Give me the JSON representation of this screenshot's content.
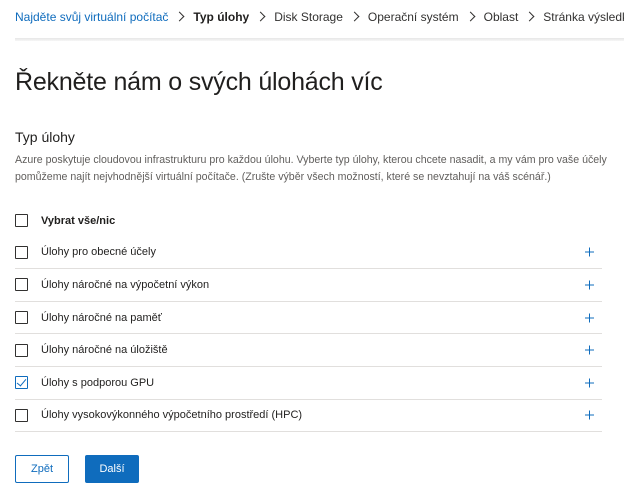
{
  "breadcrumb": {
    "items": [
      {
        "label": "Najděte svůj virtuální počítač",
        "state": "link"
      },
      {
        "label": "Typ úlohy",
        "state": "current"
      },
      {
        "label": "Disk Storage",
        "state": "default"
      },
      {
        "label": "Operační systém",
        "state": "default"
      },
      {
        "label": "Oblast",
        "state": "default"
      },
      {
        "label": "Stránka výsledků",
        "state": "default"
      }
    ]
  },
  "page": {
    "title": "Řekněte nám o svých úlohách víc",
    "section_title": "Typ úlohy",
    "description": "Azure poskytuje cloudovou infrastrukturu pro každou úlohu. Vyberte typ úlohy, kterou chcete nasadit, a my vám pro vaše účely pomůžeme najít nejvhodnější virtuální počítače. (Zrušte výběr všech možností, které se nevztahují na váš scénář.)"
  },
  "workloads": {
    "select_all": {
      "label": "Vybrat vše/nic",
      "checked": false
    },
    "items": [
      {
        "label": "Úlohy pro obecné účely",
        "checked": false,
        "expand_icon": "plus-icon"
      },
      {
        "label": "Úlohy náročné na výpočetní výkon",
        "checked": false,
        "expand_icon": "plus-icon"
      },
      {
        "label": "Úlohy náročné na paměť",
        "checked": false,
        "expand_icon": "plus-icon"
      },
      {
        "label": "Úlohy náročné na úložiště",
        "checked": false,
        "expand_icon": "plus-icon"
      },
      {
        "label": "Úlohy s podporou GPU",
        "checked": true,
        "expand_icon": "plus-icon"
      },
      {
        "label": "Úlohy vysokovýkonného výpočetního prostředí (HPC)",
        "checked": false,
        "expand_icon": "plus-icon"
      }
    ]
  },
  "actions": {
    "back_label": "Zpět",
    "next_label": "Další"
  },
  "colors": {
    "accent": "#0f6cbd",
    "text": "#201f1e",
    "muted_text": "#605e5c",
    "divider": "#e1dfdd"
  }
}
